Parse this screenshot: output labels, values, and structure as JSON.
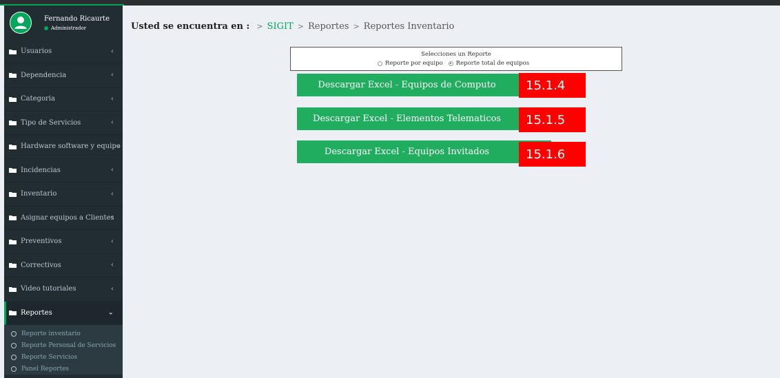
{
  "user": {
    "name": "Fernando Ricaurte",
    "role": "Administrador"
  },
  "sidebar": {
    "items": [
      {
        "label": "Usuarios",
        "chevron": "‹"
      },
      {
        "label": "Dependencia",
        "chevron": "‹"
      },
      {
        "label": "Categoria",
        "chevron": "‹"
      },
      {
        "label": "Tipo de Servicios",
        "chevron": "‹"
      },
      {
        "label": "Hardware software y equipo",
        "chevron": "‹"
      },
      {
        "label": "Incidencias",
        "chevron": "‹"
      },
      {
        "label": "Inventario",
        "chevron": "‹"
      },
      {
        "label": "Asignar equipos a Clientes",
        "chevron": "‹"
      },
      {
        "label": "Preventivos",
        "chevron": "‹"
      },
      {
        "label": "Correctivos",
        "chevron": "‹"
      },
      {
        "label": "Video tutoriales",
        "chevron": "‹"
      },
      {
        "label": "Reportes",
        "chevron": "⌄"
      }
    ],
    "subitems": [
      {
        "label": "Reporte inventario"
      },
      {
        "label": "Reporte Personal de Servicios"
      },
      {
        "label": "Reporte Servicios"
      },
      {
        "label": "Panel Reportes"
      }
    ]
  },
  "breadcrumb": {
    "label": "Usted se encuentra en :",
    "sep": ">",
    "items": [
      "SIGIT",
      "Reportes",
      "Reportes Inventario"
    ]
  },
  "report_select": {
    "title": "Selecciones un Reporte",
    "options": [
      "Reporte por equipo",
      "Reporte total de equipos"
    ],
    "selected": "Reporte total de equipos"
  },
  "buttons": [
    {
      "label": "Descargar Excel - Equipos de Computo",
      "tag": "15.1.4"
    },
    {
      "label": "Descargar Excel - Elementos Telematicos",
      "tag": "15.1.5"
    },
    {
      "label": "Descargar Excel - Equipos Invitados",
      "tag": "15.1.6"
    }
  ],
  "colors": {
    "accent": "#00a65a",
    "sidebar_bg": "#222d32",
    "button_bg": "#21ad5f",
    "tag_bg": "#fe0000",
    "content_bg": "#ecf0f5"
  },
  "icons": {
    "user": "user-circle-icon",
    "folder": "folder-icon",
    "submenu": "circle-outline-icon"
  }
}
